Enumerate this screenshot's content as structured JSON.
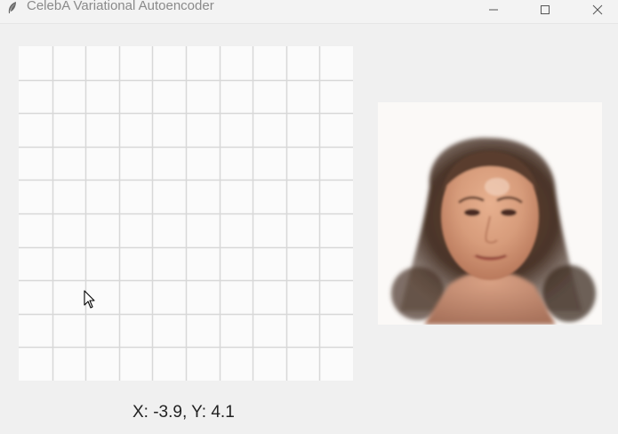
{
  "window": {
    "title": "CelebA Variational Autoencoder",
    "controls": {
      "minimize_icon": "minimize-icon",
      "maximize_icon": "maximize-icon",
      "close_icon": "close-icon"
    }
  },
  "latent_grid": {
    "columns": 10,
    "rows": 10,
    "line_color": "#d8d8d8",
    "background_color": "#fbfbfb"
  },
  "decoded_image": {
    "icon": "decoded-face-image"
  },
  "status": {
    "coordinates": "X: -3.9, Y: 4.1"
  }
}
